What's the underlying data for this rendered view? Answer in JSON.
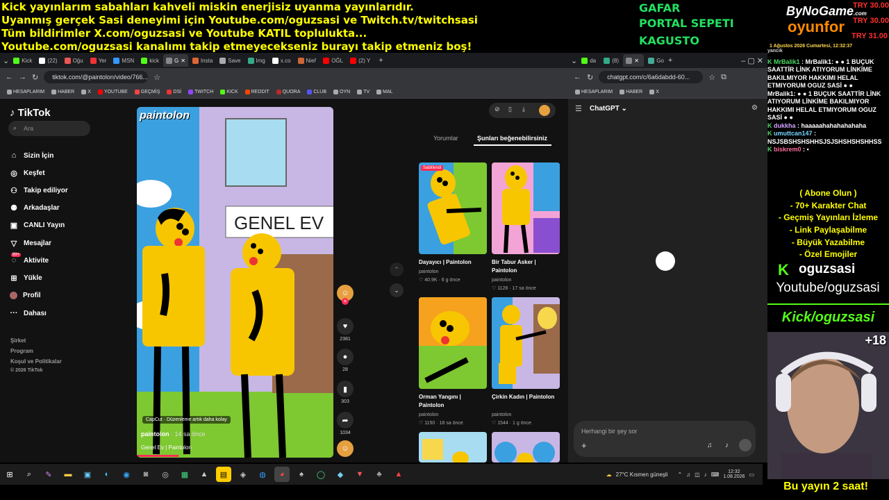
{
  "overlay": {
    "ticker_lines": [
      "Kick yayınlarım sabahları kahveli miskin enerjisiz uyanma yayınlarıdır.",
      "Uyanmış gerçek Sasi deneyimi için Youtube.com/oguzsasi ve Twitch.tv/twitchsasi",
      "Tüm bildirimler X.com/oguzsasi ve Youtube KATIL toplulukta...",
      "Youtube.com/oguzsasi kanalımı takip etmeyecekseniz burayı takip etmeniz boş!"
    ],
    "promo": [
      "GAFAR",
      "PORTAL SEPETI",
      "KAGUSTO"
    ],
    "logo_top": "ByNoGame",
    "logo_com": ".com",
    "logo_bottom": "oyunfor",
    "try_prices": [
      "TRY 30.00",
      "TRY 30.00",
      "TRY 31.00"
    ],
    "date_line": "1 Ağustos 2026 Cumartesi, 12:32:37"
  },
  "left_browser": {
    "tabs": [
      "Kick",
      "(22)",
      "Oğu",
      "Yer",
      "MSN",
      "kick",
      "G",
      "Insta",
      "Save",
      "Img",
      "x.co",
      "Nieř",
      "OĞL",
      "(2) Y"
    ],
    "url": "tiktok.com/@paintolon/video/766...",
    "bookmarks": [
      "HESAPLARIM",
      "HABER",
      "X",
      "YOUTUBE",
      "GEÇMİŞ",
      "DSİ",
      "TWITCH",
      "KICK",
      "REDDIT",
      "QUORA",
      "CLUB",
      "OYN",
      "TV",
      "MAL"
    ]
  },
  "tiktok": {
    "logo": "TikTok",
    "search_placeholder": "Ara",
    "nav": [
      {
        "label": "Sizin İçin",
        "icon": "home"
      },
      {
        "label": "Keşfet",
        "icon": "compass"
      },
      {
        "label": "Takip ediliyor",
        "icon": "person"
      },
      {
        "label": "Arkadaşlar",
        "icon": "people"
      },
      {
        "label": "CANLI Yayın",
        "icon": "live"
      },
      {
        "label": "Mesajlar",
        "icon": "send"
      },
      {
        "label": "Aktivite",
        "icon": "bell",
        "badge": "99+"
      },
      {
        "label": "Yükle",
        "icon": "plus"
      },
      {
        "label": "Profil",
        "icon": "avatar"
      },
      {
        "label": "Dahası",
        "icon": "more"
      }
    ],
    "footer": [
      "Şirket",
      "Program",
      "Koşul ve Politikalar",
      "© 2026 TikTok"
    ],
    "video": {
      "sign_text": "GENEL EV",
      "watermark": "paintolon",
      "capcut": "CapCut · Düzenleme artık daha kolay",
      "author": "paintolon",
      "time": "· 14 sa önce",
      "title": "Genel Ev | Paintolon"
    },
    "actions": {
      "likes": "2381",
      "comments": "28",
      "saves": "303",
      "shares": "1034"
    },
    "tabs": [
      "Yorumlar",
      "Şunları beğenebilirsiniz"
    ],
    "pinned": "Sabitlendi",
    "suggestions": [
      {
        "title": "Dayayıcı | Paintolon",
        "author": "paintolon",
        "meta": "♡ 40.9K · 6 g önce"
      },
      {
        "title": "Bir Tabur Asker | Paintolon",
        "author": "paintolon",
        "meta": "♡ 1128 · 17 sa önce"
      },
      {
        "title": "Orman Yangını | Paintolon",
        "author": "paintolon",
        "meta": "♡ 1150 · 18 sa önce"
      },
      {
        "title": "Çirkin Kadın | Paintolon",
        "author": "paintolon",
        "meta": "♡ 1544 · 1 g önce"
      }
    ]
  },
  "right_browser": {
    "tabs": [
      "da",
      "(8)",
      "Go"
    ],
    "url": "chatgpt.com/c/6a6dabdd-60...",
    "bookmarks": [
      "HESAPLARIM",
      "HABER",
      "X"
    ],
    "model": "ChatGPT",
    "input_placeholder": "Herhangi bir şey sor"
  },
  "chat": {
    "top_cut": "yancık",
    "messages": [
      {
        "user": "MrBalik1",
        "text": "MrBalik1: ● ● 1 BUÇUK SAATTİR LİNK ATIYORUM LİNKİME BAKILMIYOR HAKKIMI HELAL ETMIYORUM OGUZ SASİ ● ●"
      },
      {
        "user": "MrBalik1",
        "text": "● ● 1 BUÇUK SAATTİR LİNK ATIYORUM LİNKİME BAKILMIYOR HAKKIMI HELAL ETMIYORUM OGUZ SASİ ● ●"
      },
      {
        "user": "dukkha",
        "text": "haaaaahahahahahaha"
      },
      {
        "user": "umuttcan147",
        "text": "NSJSBSHSHSHHSJSJSHSHSHSHHSS"
      },
      {
        "user": "biskrem0",
        "text": "▪"
      }
    ]
  },
  "subscribe": {
    "lines": [
      "( Abone Olun )",
      "- 70+ Karakter Chat",
      "- Geçmiş Yayınları İzleme",
      "- Link Paylaşabilme",
      "- Büyük Yazabilme",
      "- Özel Emojiler"
    ],
    "kick_name": "oguzsasi",
    "youtube": "Youtube/oguzsasi",
    "kick_url": "Kick/oguzsasi",
    "viewer_badge": "+18",
    "bottom": "Bu yayın 2 saat!"
  },
  "taskbar": {
    "weather": "27°C  Kısmen güneşli",
    "time": "12:32",
    "date": "1.08.2026"
  }
}
